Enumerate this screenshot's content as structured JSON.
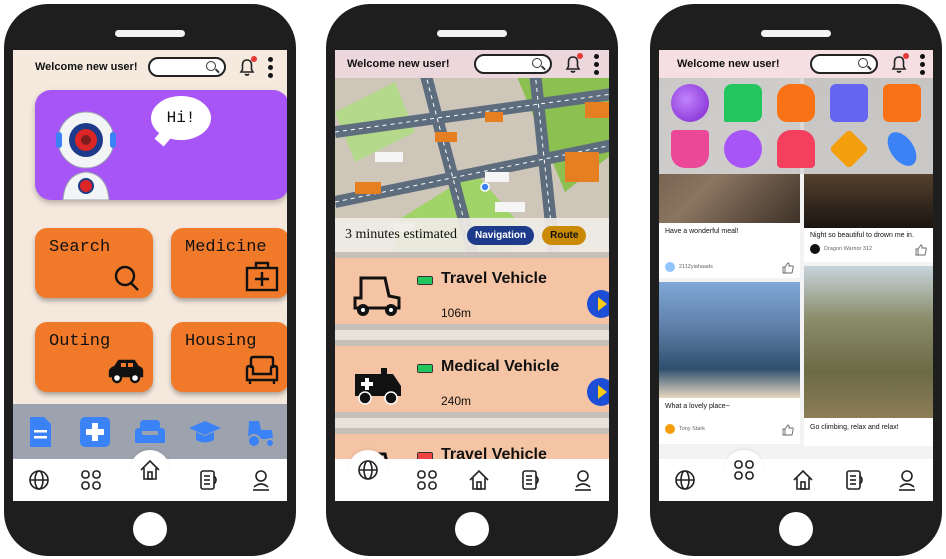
{
  "welcome_text": "Welcome new user!",
  "colors": {
    "hero_purple": "#a855f7",
    "tile_orange": "#f07a2a",
    "screen_bg": "#f5e9de",
    "vehicle_card": "#f5c4a4",
    "nav_button": "#1e3a8a",
    "route_button": "#ca8a04",
    "strip_gray": "#9ca3af",
    "icon_blue": "#3b82f6",
    "battery_green": "#22c55e",
    "battery_red": "#ef4444"
  },
  "nav_icons": [
    "globe-icon",
    "apps-grid-icon",
    "home-icon",
    "document-icon",
    "profile-icon"
  ],
  "screen1": {
    "greeting": "Hi!",
    "tiles": [
      {
        "label": "Search",
        "icon": "search-icon"
      },
      {
        "label": "Medicine",
        "icon": "medical-kit-icon"
      },
      {
        "label": "Outing",
        "icon": "car-icon"
      },
      {
        "label": "Housing",
        "icon": "armchair-icon"
      }
    ],
    "category_icons": [
      "document-icon",
      "medical-plus-icon",
      "sofa-icon",
      "graduation-cap-icon",
      "tractor-icon"
    ]
  },
  "screen2": {
    "estimate": "3 minutes estimated",
    "navigation_label": "Navigation",
    "route_label": "Route",
    "vehicles": [
      {
        "name": "Travel Vehicle",
        "distance": "106m",
        "battery": "green",
        "icon": "golf-cart-icon"
      },
      {
        "name": "Medical Vehicle",
        "distance": "240m",
        "battery": "green",
        "icon": "ambulance-icon"
      },
      {
        "name": "Travel Vehicle",
        "distance": "",
        "battery": "red",
        "icon": "golf-cart-icon"
      }
    ]
  },
  "screen3": {
    "app_icons": [
      "palette-icon",
      "chat-icon",
      "hand-icon",
      "shopping-bag-icon",
      "calendar-icon",
      "coffee-cup-icon",
      "film-reel-icon",
      "store-icon",
      "heart-check-icon",
      "link-icon"
    ],
    "posts": [
      {
        "caption": "Have a wonderful meal!",
        "author": "2112yiahaads"
      },
      {
        "caption": "Night so beautiful to drown me in.",
        "author": "Dragon Warrior 312"
      },
      {
        "caption": "What a lovely place~",
        "author": "Tony Stark"
      },
      {
        "caption": "Go climbing, relax and relax!",
        "author": ""
      }
    ]
  }
}
